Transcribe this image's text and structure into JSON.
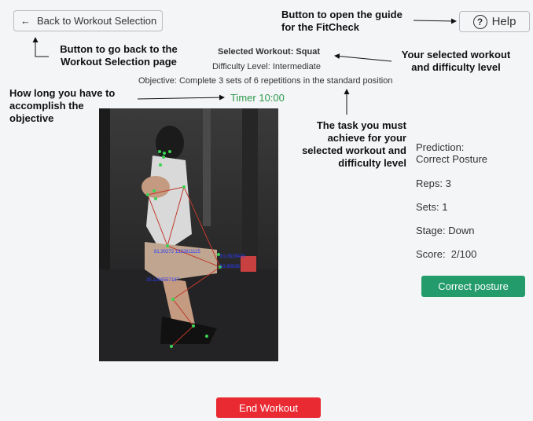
{
  "nav": {
    "back_label": "Back to Workout Selection",
    "help_label": "Help"
  },
  "annotations": {
    "help_guide": [
      "Button to open the guide",
      "for the FitCheck"
    ],
    "back_page": [
      "Button to go back to the",
      "Workout Selection page"
    ],
    "selected_workout": [
      "Your selected workout",
      "and difficulty level"
    ],
    "time_limit": [
      "How long you have to",
      "accomplish the",
      "objective"
    ],
    "task": [
      "The task you must",
      "achieve for your",
      "selected workout and",
      "difficulty level"
    ]
  },
  "workout": {
    "title": "Selected Workout: Squat",
    "difficulty": "Difficulty Level: Intermediate",
    "objective": "Objective: Complete 3 sets of 6 repetitions in the standard position",
    "timer": "Timer 10:00"
  },
  "video": {
    "angle_labels": [
      "81.30272 1332811115",
      "81.0816426",
      "53.89936",
      "35.1206557187"
    ]
  },
  "stats": {
    "prediction_label": "Prediction:",
    "prediction_value": "Correct Posture",
    "reps": "Reps: 3",
    "sets": "Sets: 1",
    "stage": "Stage: Down",
    "score": "Score:  2/100"
  },
  "status_button": "Correct posture",
  "end_button": "End Workout",
  "colors": {
    "background": "#f4f5f7",
    "timer": "#2e9a4c",
    "status_green": "#239b6b",
    "end_red": "#ea2a33",
    "skeleton_line": "#c0392b",
    "keypoint": "#39d353",
    "angle_text": "#2a3cff"
  }
}
